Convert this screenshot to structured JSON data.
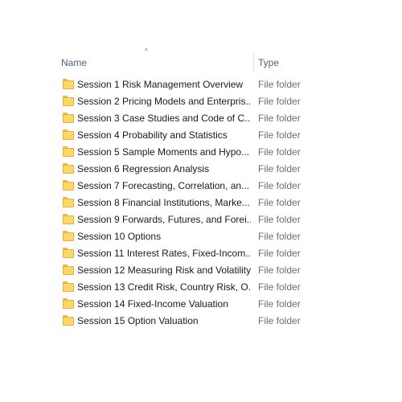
{
  "header": {
    "name_label": "Name",
    "type_label": "Type",
    "sort_indicator": "^"
  },
  "colors": {
    "folder_fill": "#ffd767",
    "folder_border": "#e3b13f",
    "header_text": "#4c607a",
    "type_text": "#6d6d6d"
  },
  "items": [
    {
      "name": "Session 1 Risk Management Overview",
      "type": "File folder",
      "icon": "folder-icon"
    },
    {
      "name": "Session 2 Pricing Models and Enterpris...",
      "type": "File folder",
      "icon": "folder-icon"
    },
    {
      "name": "Session 3 Case Studies and Code of C...",
      "type": "File folder",
      "icon": "folder-icon"
    },
    {
      "name": "Session 4 Probability and Statistics",
      "type": "File folder",
      "icon": "folder-icon"
    },
    {
      "name": "Session 5 Sample Moments and Hypo...",
      "type": "File folder",
      "icon": "folder-icon"
    },
    {
      "name": "Session 6 Regression Analysis",
      "type": "File folder",
      "icon": "folder-icon"
    },
    {
      "name": "Session 7 Forecasting, Correlation, an...",
      "type": "File folder",
      "icon": "folder-icon"
    },
    {
      "name": "Session 8 Financial Institutions, Marke...",
      "type": "File folder",
      "icon": "folder-icon"
    },
    {
      "name": "Session 9 Forwards, Futures, and Forei...",
      "type": "File folder",
      "icon": "folder-icon"
    },
    {
      "name": "Session 10 Options",
      "type": "File folder",
      "icon": "folder-icon"
    },
    {
      "name": "Session 11 Interest Rates, Fixed-Incom...",
      "type": "File folder",
      "icon": "folder-icon"
    },
    {
      "name": "Session 12 Measuring Risk and Volatility",
      "type": "File folder",
      "icon": "folder-icon"
    },
    {
      "name": "Session 13 Credit Risk, Country Risk, O...",
      "type": "File folder",
      "icon": "folder-icon"
    },
    {
      "name": "Session 14 Fixed-Income Valuation",
      "type": "File folder",
      "icon": "folder-icon"
    },
    {
      "name": "Session 15 Option Valuation",
      "type": "File folder",
      "icon": "folder-icon"
    }
  ]
}
